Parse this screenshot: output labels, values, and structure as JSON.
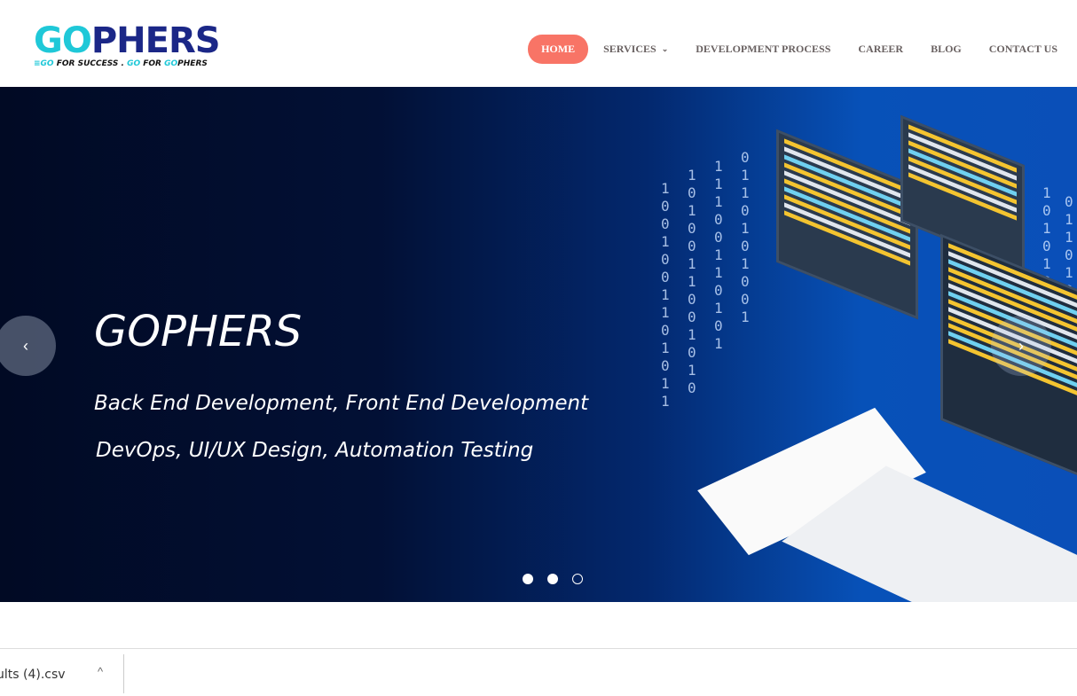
{
  "logo": {
    "brand": "GOPHERS",
    "tagline_parts": [
      "GO",
      " FOR SUCCESS . ",
      "GO",
      " FOR ",
      "GO",
      "PHERS"
    ]
  },
  "nav": {
    "items": [
      {
        "label": "HOME"
      },
      {
        "label": "SERVICES"
      },
      {
        "label": "DEVELOPMENT PROCESS"
      },
      {
        "label": "CAREER"
      },
      {
        "label": "BLOG"
      },
      {
        "label": "CONTACT US"
      }
    ],
    "active": "HOME"
  },
  "hero": {
    "title": "GOPHERS",
    "subtitle_1": "Back End Development, Front End Development",
    "subtitle_2": "DevOps, UI/UX Design, Automation Testing",
    "prev_icon": "‹",
    "next_icon": "›",
    "slides": 3,
    "active_slide": 1
  },
  "download_bar": {
    "filename": "ults (4).csv",
    "chevron": "^"
  },
  "colors": {
    "accent": "#f87466",
    "brand_navy": "#1b2787",
    "brand_cyan": "#1fc8d8"
  }
}
